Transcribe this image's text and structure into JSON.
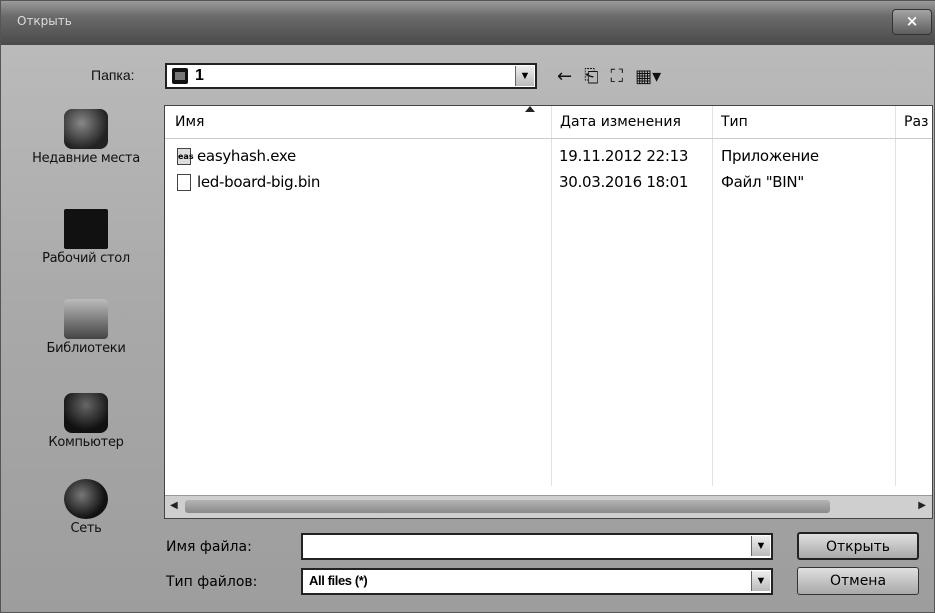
{
  "window": {
    "title": "Открыть",
    "close_label": "×"
  },
  "folder": {
    "label": "Папка:",
    "value": "1"
  },
  "toolbar": {
    "back": "←",
    "up": "⎗",
    "new_folder": "⛶",
    "view": "▦▾"
  },
  "places": [
    {
      "label": "Недавние места",
      "icon": "recent-places-icon"
    },
    {
      "label": "Рабочий стол",
      "icon": "desktop-icon"
    },
    {
      "label": "Библиотеки",
      "icon": "libraries-icon"
    },
    {
      "label": "Компьютер",
      "icon": "computer-icon"
    },
    {
      "label": "Сеть",
      "icon": "network-icon"
    }
  ],
  "columns": {
    "name": "Имя",
    "modified": "Дата изменения",
    "type": "Тип",
    "size": "Раз"
  },
  "files": [
    {
      "name": "easyhash.exe",
      "modified": "19.11.2012 22:13",
      "type": "Приложение",
      "icon": "exe-icon",
      "icon_text": "eas"
    },
    {
      "name": "led-board-big.bin",
      "modified": "30.03.2016 18:01",
      "type": "Файл \"BIN\"",
      "icon": "file-icon",
      "icon_text": ""
    }
  ],
  "filename": {
    "label": "Имя файла:",
    "value": ""
  },
  "filetype": {
    "label": "Тип файлов:",
    "value": "All files (*)"
  },
  "buttons": {
    "open": "Открыть",
    "cancel": "Отмена"
  }
}
